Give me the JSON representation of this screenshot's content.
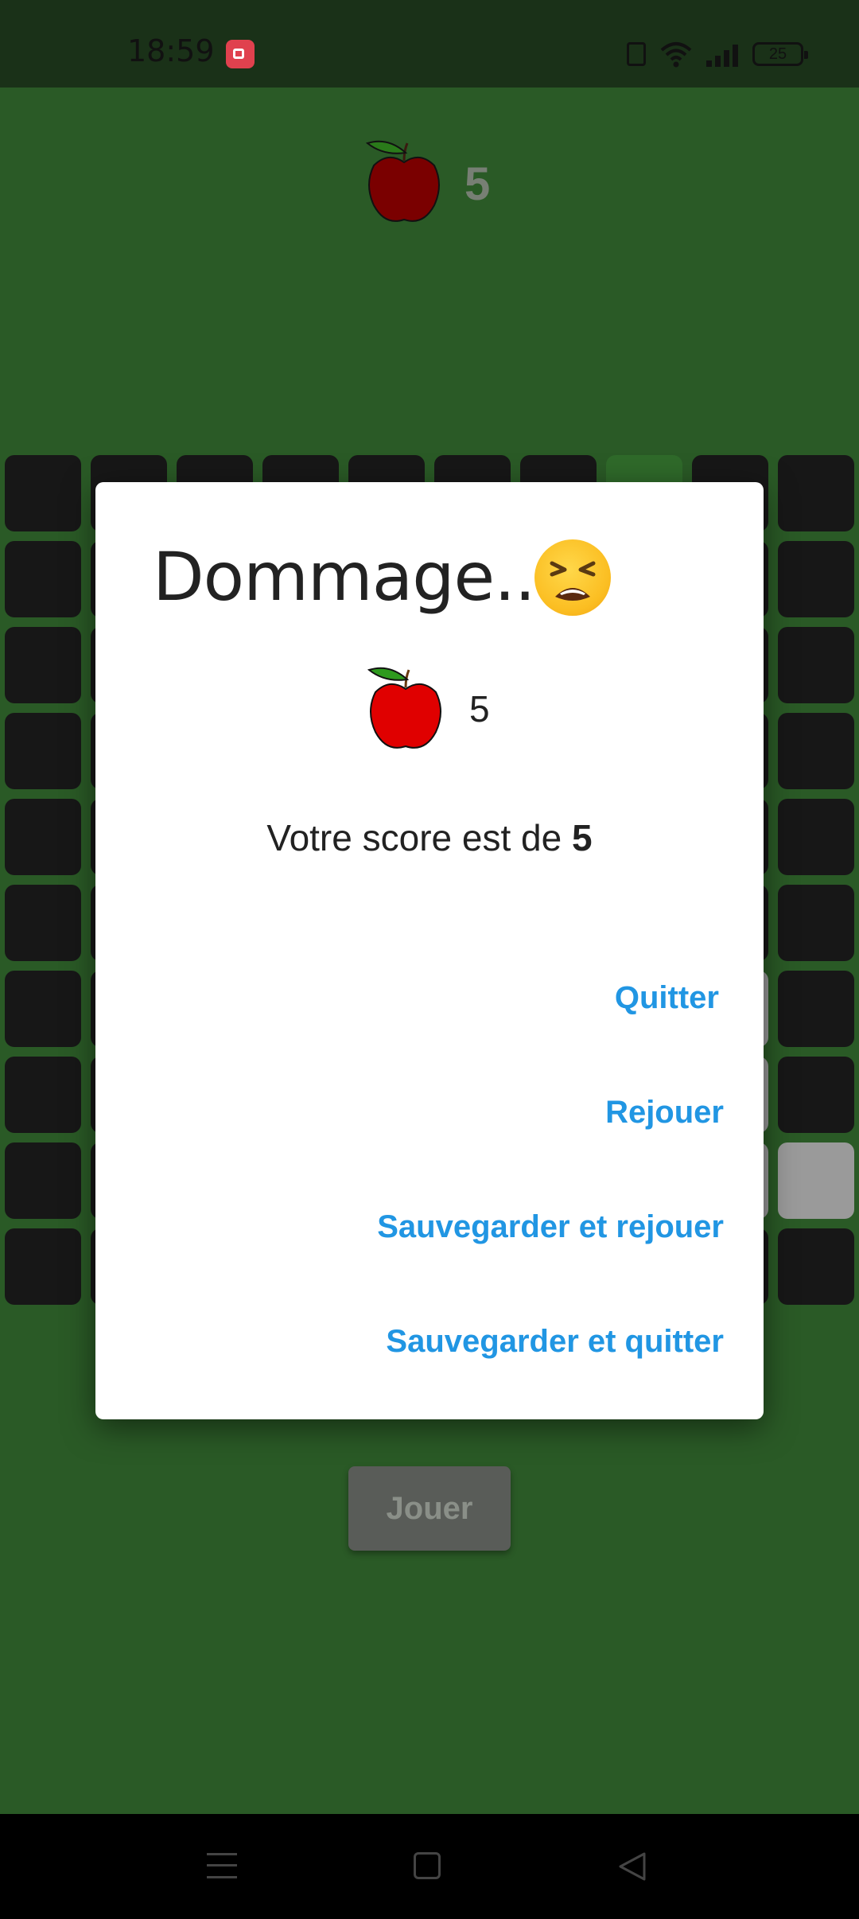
{
  "status_bar": {
    "time": "18:59",
    "battery": "25",
    "icons": [
      "screen-record-icon",
      "vibrate-icon",
      "wifi-icon",
      "signal-icon",
      "battery-icon"
    ]
  },
  "game": {
    "score": "5",
    "play_button": "Jouer",
    "grid": {
      "rows": 10,
      "cols": 10
    }
  },
  "dialog": {
    "title": "Dommage...",
    "emoji": "tired-face-icon",
    "apples_count": "5",
    "score_text": "Votre score est de ",
    "score_value": "5",
    "actions": {
      "quit": "Quitter",
      "replay": "Rejouer",
      "save_replay": "Sauvegarder et rejouer",
      "save_quit": "Sauvegarder et quitter"
    }
  },
  "nav_bar": {
    "icons": [
      "menu-icon",
      "home-icon",
      "back-icon"
    ]
  },
  "colors": {
    "background": "#2a5a26",
    "cell": "#171717",
    "accent": "#2196e3",
    "apple": "#e00000"
  }
}
